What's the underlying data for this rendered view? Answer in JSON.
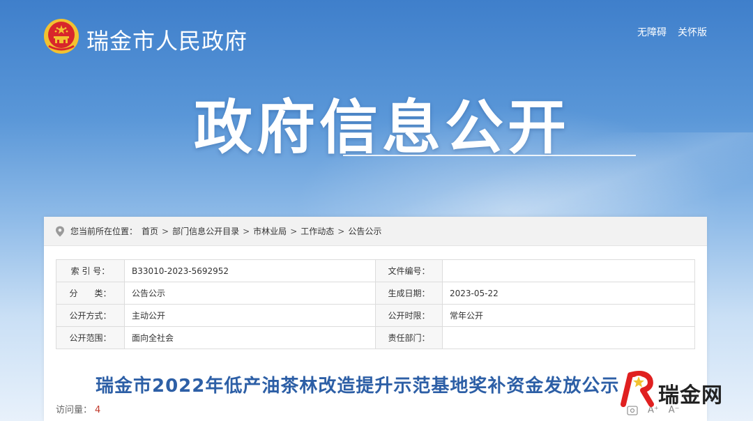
{
  "header": {
    "site_name": "瑞金市人民政府",
    "links": [
      "无障碍",
      "关怀版"
    ]
  },
  "hero": {
    "title": "政府信息公开"
  },
  "breadcrumb": {
    "prefix": "您当前所在位置：",
    "items": [
      "首页",
      "部门信息公开目录",
      "市林业局",
      "工作动态",
      "公告公示"
    ],
    "separator": ">"
  },
  "meta": {
    "rows": [
      {
        "label1": "索 引 号：",
        "value1": "B33010-2023-5692952",
        "label2": "文件编号：",
        "value2": ""
      },
      {
        "label1": "分　　类：",
        "value1": "公告公示",
        "label2": "生成日期：",
        "value2": "2023-05-22"
      },
      {
        "label1": "公开方式：",
        "value1": "主动公开",
        "label2": "公开时限：",
        "value2": "常年公开"
      },
      {
        "label1": "公开范围：",
        "value1": "面向全社会",
        "label2": "责任部门：",
        "value2": ""
      }
    ]
  },
  "document": {
    "title": "瑞金市2022年低产油茶林改造提升示范基地奖补资金发放公示",
    "visits_label": "访问量：",
    "visits_count": "4"
  },
  "tools": {
    "font_larger": "A⁺",
    "font_smaller": "A⁻"
  },
  "watermark": {
    "text": "瑞金网"
  },
  "colors": {
    "title_blue": "#2d5fa6",
    "emblem_red": "#d8262b",
    "emblem_gold": "#f2c230"
  }
}
